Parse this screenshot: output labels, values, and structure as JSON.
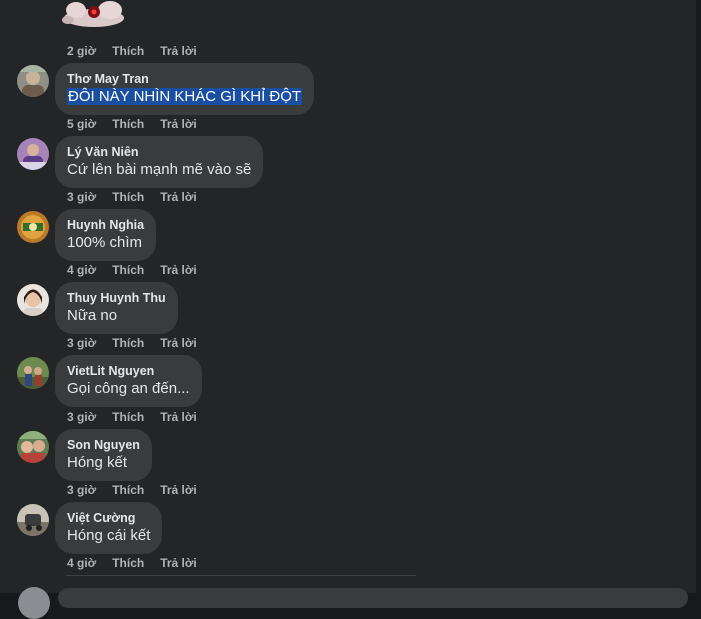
{
  "actions": {
    "like": "Thích",
    "reply": "Trả lời"
  },
  "top": {
    "time": "2 giờ"
  },
  "comments": [
    {
      "name": "Thơ May Tran",
      "text": "ĐÔI NÀY NHÌN KHÁC GÌ KHỈ ĐỘT",
      "time": "5 giờ"
    },
    {
      "name": "Lý Văn Niên",
      "text": "Cứ lên bài mạnh mẽ vào sẽ",
      "time": "3 giờ"
    },
    {
      "name": "Huynh Nghia",
      "text": "100% chìm",
      "time": "4 giờ"
    },
    {
      "name": "Thuy Huynh Thu",
      "text": "Nữa no",
      "time": "3 giờ"
    },
    {
      "name": "VietLit Nguyen",
      "text": "Gọi công an đến...",
      "time": "3 giờ"
    },
    {
      "name": "Son Nguyen",
      "text": "Hóng kết",
      "time": "3 giờ"
    },
    {
      "name": "Việt Cường",
      "text": "Hóng cái kết",
      "time": "4 giờ"
    }
  ]
}
